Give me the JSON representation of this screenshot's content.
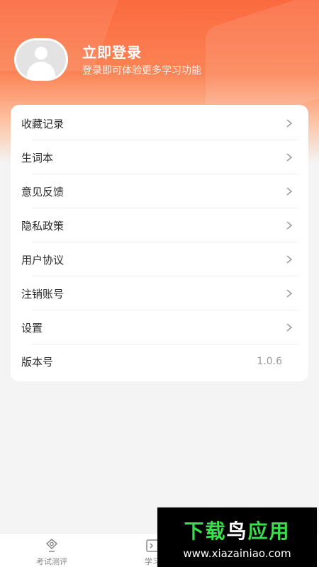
{
  "profile": {
    "title": "立即登录",
    "subtitle": "登录即可体验更多学习功能"
  },
  "menu": {
    "items": [
      {
        "label": "收藏记录"
      },
      {
        "label": "生词本"
      },
      {
        "label": "意见反馈"
      },
      {
        "label": "隐私政策"
      },
      {
        "label": "用户协议"
      },
      {
        "label": "注销账号"
      },
      {
        "label": "设置"
      },
      {
        "label": "版本号",
        "value": "1.0.6"
      }
    ]
  },
  "tabbar": {
    "tabs": [
      {
        "label": "考试测评",
        "icon": "badge-icon"
      },
      {
        "label": "学习",
        "icon": "book-icon"
      }
    ]
  },
  "watermark": {
    "title_part1": "下载",
    "title_part2": "鸟",
    "title_part3": "应用",
    "url": "www.xiazainiao.com"
  },
  "colors": {
    "accent": "#fb6a3f"
  }
}
